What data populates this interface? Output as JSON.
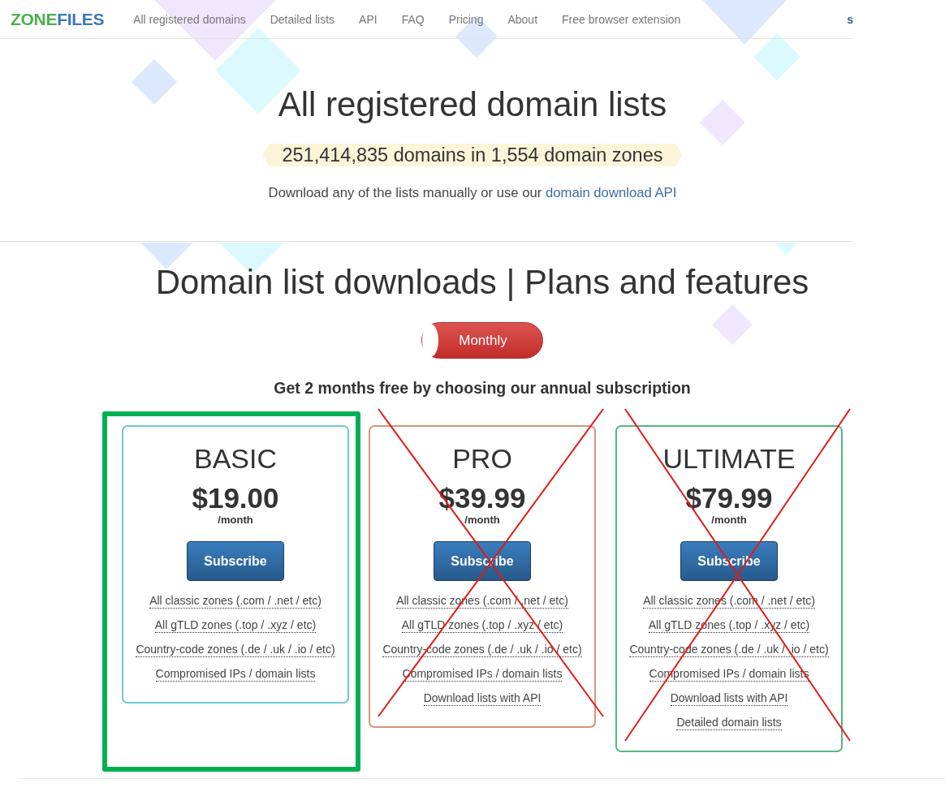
{
  "header": {
    "logo": [
      "ZONE",
      "FILES"
    ],
    "nav": [
      "All registered domains",
      "Detailed lists",
      "API",
      "FAQ",
      "Pricing",
      "About",
      "Free browser extension"
    ],
    "cut_link": "s"
  },
  "hero": {
    "title": "All registered domain lists",
    "stats": "251,414,835 domains in 1,554 domain zones",
    "intro": "Download any of the lists manually or use our",
    "intro_link": "domain download API"
  },
  "pricing": {
    "title": "Domain list downloads | Plans and features",
    "billing_toggle": {
      "label": "Monthly",
      "annual": false
    },
    "offer": "Get 2 months free by choosing our annual subscription",
    "plans": [
      {
        "name": "BASIC",
        "price": "$19.00",
        "period": "/month",
        "button": "Subscribe",
        "color": "#6fc5d3",
        "highlighted": true,
        "crossed_out": false,
        "features": [
          "All classic zones (.com / .net / etc)",
          "All gTLD zones (.top / .xyz / etc)",
          "Country-code zones (.de / .uk / .io / etc)",
          "Compromised IPs / domain lists"
        ]
      },
      {
        "name": "PRO",
        "price": "$39.99",
        "period": "/month",
        "button": "Subscribe",
        "color": "#d4967a",
        "highlighted": false,
        "crossed_out": true,
        "features": [
          "All classic zones (.com / .net / etc)",
          "All gTLD zones (.top / .xyz / etc)",
          "Country-code zones (.de / .uk / .io / etc)",
          "Compromised IPs / domain lists",
          "Download lists with API"
        ]
      },
      {
        "name": "ULTIMATE",
        "price": "$79.99",
        "period": "/month",
        "button": "Subscribe",
        "color": "#52b97c",
        "highlighted": false,
        "crossed_out": true,
        "features": [
          "All classic zones (.com / .net / etc)",
          "All gTLD zones (.top / .xyz / etc)",
          "Country-code zones (.de / .uk / .io / etc)",
          "Compromised IPs / domain lists",
          "Download lists with API",
          "Detailed domain lists"
        ]
      }
    ]
  }
}
